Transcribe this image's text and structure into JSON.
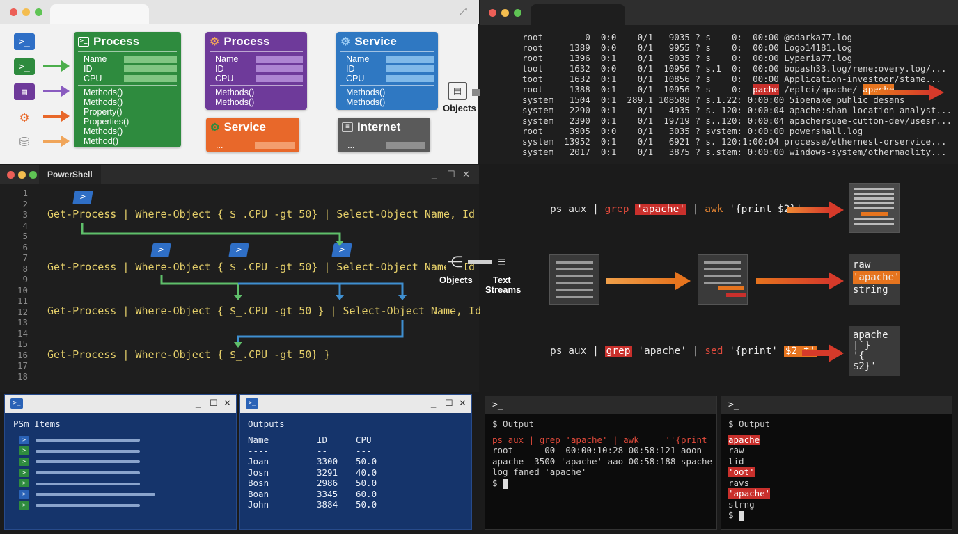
{
  "object_diagram": {
    "cards": [
      {
        "title": "Process",
        "color": "#2e8b3e",
        "props": [
          "Name",
          "ID",
          "CPU"
        ],
        "methods": [
          "Methods()",
          "Methods()",
          "Property()",
          "Properties()",
          "Methods()",
          "Method()"
        ]
      },
      {
        "title": "Process",
        "color": "#6e3a9a",
        "props": [
          "Name",
          "ID",
          "CPU"
        ],
        "methods": [
          "Methods()",
          "Methods()"
        ]
      },
      {
        "title": "Service",
        "color": "#2f78c2",
        "props": [
          "Name",
          "ID",
          "CPU"
        ],
        "methods": [
          "Methods()",
          "Methods()"
        ]
      },
      {
        "title": "Service",
        "color": "#e8682a",
        "props": [
          "..."
        ]
      },
      {
        "title": "Internet",
        "color": "#5a5a5a",
        "props": [
          "..."
        ]
      }
    ],
    "objects_label": "Objects"
  },
  "ps_listing": {
    "lines": [
      "root        0  0:0    0/1   9035 ? s    0:  00:00 @sdarka77.log",
      "root     1389  0:0    0/1   9955 ? s    0:  00:00 Logo14181.log",
      "root     1396  0:1    0/1   9035 ? s    0:  00:00 Lyperia77.log",
      "toot     1632  0:0    0/1  10956 ? s.1  0:  00:00 bopash33.log/rene:overy.log/...",
      "toot     1632  0:1    0/1  10856 ? s    0:  00:00 Application-investoor/stame...",
      "system   1504  0:1  289.1 108588 ? s.1.22: 0:00:00 5ioenaxe puhlic desans",
      "system   2290  0:1    0/1   4935 ? s. 120: 0:00:04 apache:shan-location-analyst...",
      "system   2390  0:1    0/1  19719 ? s..120: 0:00:04 apachersuae-cutton-dev/usesr...",
      "root     3905  0:0    0/1   3035 ? svstem: 0:00:00 powershall.log",
      "system  13952  0:1    0/1   6921 ? s. 120:1:00:04 processe/ethernest-orservice...",
      "system   2017  0:1    0/1   3875 ? s.stem: 0:00:00 windows-system/othermaolity..."
    ],
    "highlight_line": {
      "prefix": "root     1388  0:1    0/1  10956 ? s    0:  ",
      "tag_red": "pache",
      "middle": " /eplci/apache/ ",
      "tag_orange": "apache"
    }
  },
  "powershell_editor": {
    "tab": "PowerShell",
    "line_numbers": [
      "1",
      "2",
      "3",
      "4",
      "5",
      "6",
      "7",
      "8",
      "9",
      "10",
      "11",
      "12",
      "13",
      "14",
      "15",
      "16",
      "17",
      "18"
    ],
    "code": [
      "Get-Process | Where-Object { $_.CPU -gt 50} | Select-Object Name, Id",
      "Get-Process | Where-Object { $_.CPU -gt 50} | Select-Object Name, Id",
      "Get-Process | Where-Object { $_.CPU -gt 50 } | Select-Object Name, Id",
      "Get-Process | Where-Object { $_.CPU -gt 50} }"
    ]
  },
  "middle_labels": {
    "objects": "Objects",
    "text_streams_1": "Text",
    "text_streams_2": "Streams"
  },
  "text_pipeline": {
    "cmd1": {
      "a": "ps aux | ",
      "b": "grep",
      "c": "'apache'",
      "d": " | ",
      "e": "awk",
      "f": " '{print $2}'"
    },
    "cmd2": {
      "a": "ps aux | ",
      "b": "grep",
      "c": " 'apache' | ",
      "d": "sed",
      "e": " '{print' ",
      "f": "$2 t'"
    },
    "result1": [
      "raw",
      "'apache'",
      "string"
    ],
    "result2": [
      "apache",
      "|`}",
      "'{",
      "$2}'"
    ]
  },
  "items_pane": {
    "title": "PSm Items",
    "icon_colors": [
      "#2a62b6",
      "#2e8b3e",
      "#2e8b3e",
      "#2e8b3e",
      "#2e8b3e",
      "#2a62b6",
      "#2e8b3e"
    ]
  },
  "outputs_pane": {
    "title": "Outputs",
    "headers": [
      "Name",
      "ID",
      "CPU"
    ],
    "divider": [
      "----",
      "--",
      "---"
    ],
    "rows": [
      [
        "Joan",
        "3300",
        "50.0"
      ],
      [
        "Josn",
        "3291",
        "40.0"
      ],
      [
        "Bosn",
        "2986",
        "50.0"
      ],
      [
        "Boan",
        "3345",
        "60.0"
      ],
      [
        "John",
        "3884",
        "50.0"
      ]
    ]
  },
  "terminal1": {
    "prompt_bar": ">_",
    "header": "$ Output",
    "cmd_a": "ps aux | ",
    "cmd_b": "grep",
    "cmd_c": " 'apache' | ",
    "cmd_d": "awk",
    "cmd_e": "     ''{print",
    "lines": [
      "root      00  00:00:10:28 00:58:121 aoon",
      "apache  3500 'apache' aao 00:58:188 spache",
      "log faned 'apache'"
    ],
    "prompt": "$ "
  },
  "terminal2": {
    "prompt_bar": ">_",
    "header": "$ Output",
    "items": [
      "apache",
      "raw",
      "lid",
      "'oot'",
      "ravs",
      "'apache'",
      "strng"
    ],
    "highlighted": [
      true,
      false,
      false,
      true,
      false,
      true,
      false
    ],
    "prompt": "$ "
  }
}
